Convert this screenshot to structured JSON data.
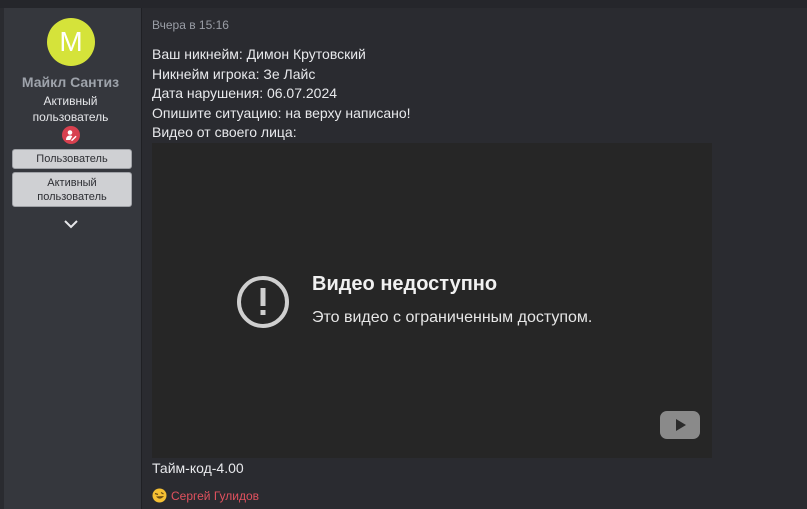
{
  "user": {
    "avatar_letter": "M",
    "avatar_color": "#d5e33a",
    "name": "Майкл Сантиз",
    "title": "Активный пользователь",
    "banners": [
      "Пользователь",
      "Активный пользователь"
    ],
    "role_icon": "user-edit-icon",
    "expand_icon": "chevron-down-icon"
  },
  "post": {
    "timestamp": "Вчера в 15:16",
    "lines": [
      "Ваш никнейм: Димон Крутовский",
      "Никнейм игрока: Зе Лайс",
      "Дата нарушения: 06.07.2024",
      "Опишите ситуацию: на верху написано!",
      "Видео от своего лица:"
    ],
    "video": {
      "title": "Видео недоступно",
      "subtitle": "Это видео с ограниченным доступом.",
      "warning_icon": "exclamation-circle-icon",
      "logo_icon": "youtube-icon"
    },
    "timecode": "Тайм-код-4.00"
  },
  "reaction": {
    "emoji_icon": "rofl-emoji-icon",
    "name": "Сергей Гулидов",
    "name_color": "#e0515e"
  }
}
